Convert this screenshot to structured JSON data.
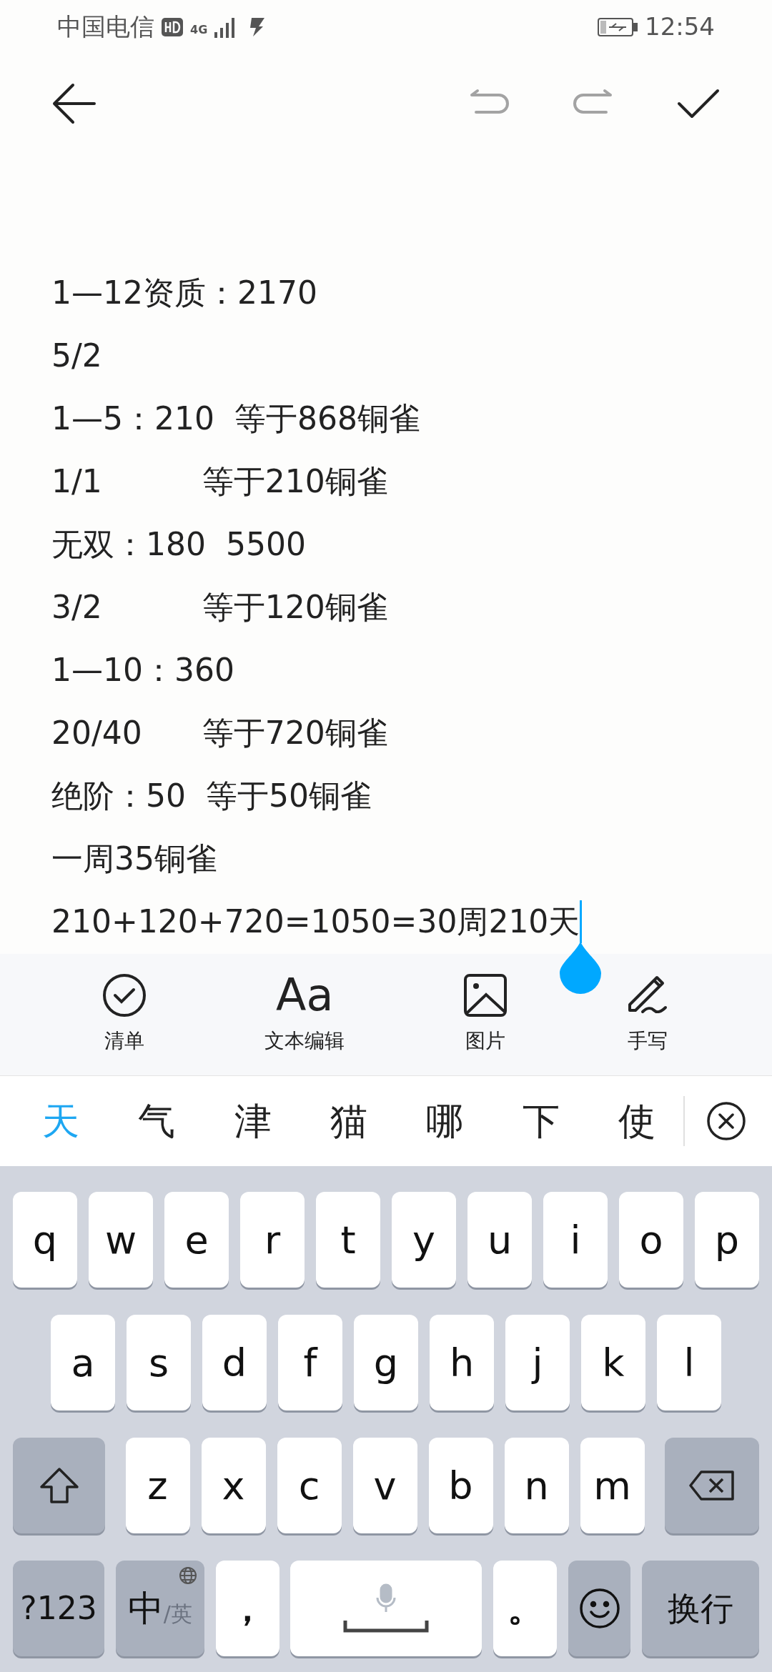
{
  "status_bar": {
    "carrier": "中国电信",
    "network": "4G",
    "time": "12:54"
  },
  "top_bar": {
    "actions": [
      {
        "kind": "undo",
        "disabled": true
      },
      {
        "kind": "redo",
        "disabled": true
      },
      {
        "kind": "done",
        "disabled": false
      }
    ]
  },
  "note": {
    "lines": [
      "1—12资质：2170",
      "5/2",
      "1—5：210  等于868铜雀",
      "1/1          等于210铜雀",
      "无双：180  5500",
      "3/2          等于120铜雀",
      "1—10：360",
      "20/40      等于720铜雀",
      "绝阶：50  等于50铜雀",
      "一周35铜雀",
      "210+120+720=1050=30周210天"
    ]
  },
  "tools": [
    {
      "kind": "checklist",
      "label": "清单"
    },
    {
      "kind": "text",
      "label": "文本编辑",
      "glyph": "Aa"
    },
    {
      "kind": "image",
      "label": "图片"
    },
    {
      "kind": "handwriting",
      "label": "手写"
    }
  ],
  "candidates": [
    {
      "text": "天",
      "selected": true
    },
    {
      "text": "气",
      "selected": false
    },
    {
      "text": "津",
      "selected": false
    },
    {
      "text": "猫",
      "selected": false
    },
    {
      "text": "哪",
      "selected": false
    },
    {
      "text": "下",
      "selected": false
    },
    {
      "text": "使",
      "selected": false
    }
  ],
  "keyboard": {
    "rows": [
      [
        "q",
        "w",
        "e",
        "r",
        "t",
        "y",
        "u",
        "i",
        "o",
        "p"
      ],
      [
        "a",
        "s",
        "d",
        "f",
        "g",
        "h",
        "j",
        "k",
        "l"
      ],
      [
        "z",
        "x",
        "c",
        "v",
        "b",
        "n",
        "m"
      ]
    ],
    "bottom_row": [
      {
        "kind": "symbols",
        "label": "?123"
      },
      {
        "kind": "language",
        "label": "中",
        "sub": "/英"
      },
      {
        "kind": "char",
        "label": "，"
      },
      {
        "kind": "space"
      },
      {
        "kind": "char",
        "label": "。"
      },
      {
        "kind": "emoji"
      },
      {
        "kind": "enter",
        "label": "换行"
      }
    ]
  }
}
